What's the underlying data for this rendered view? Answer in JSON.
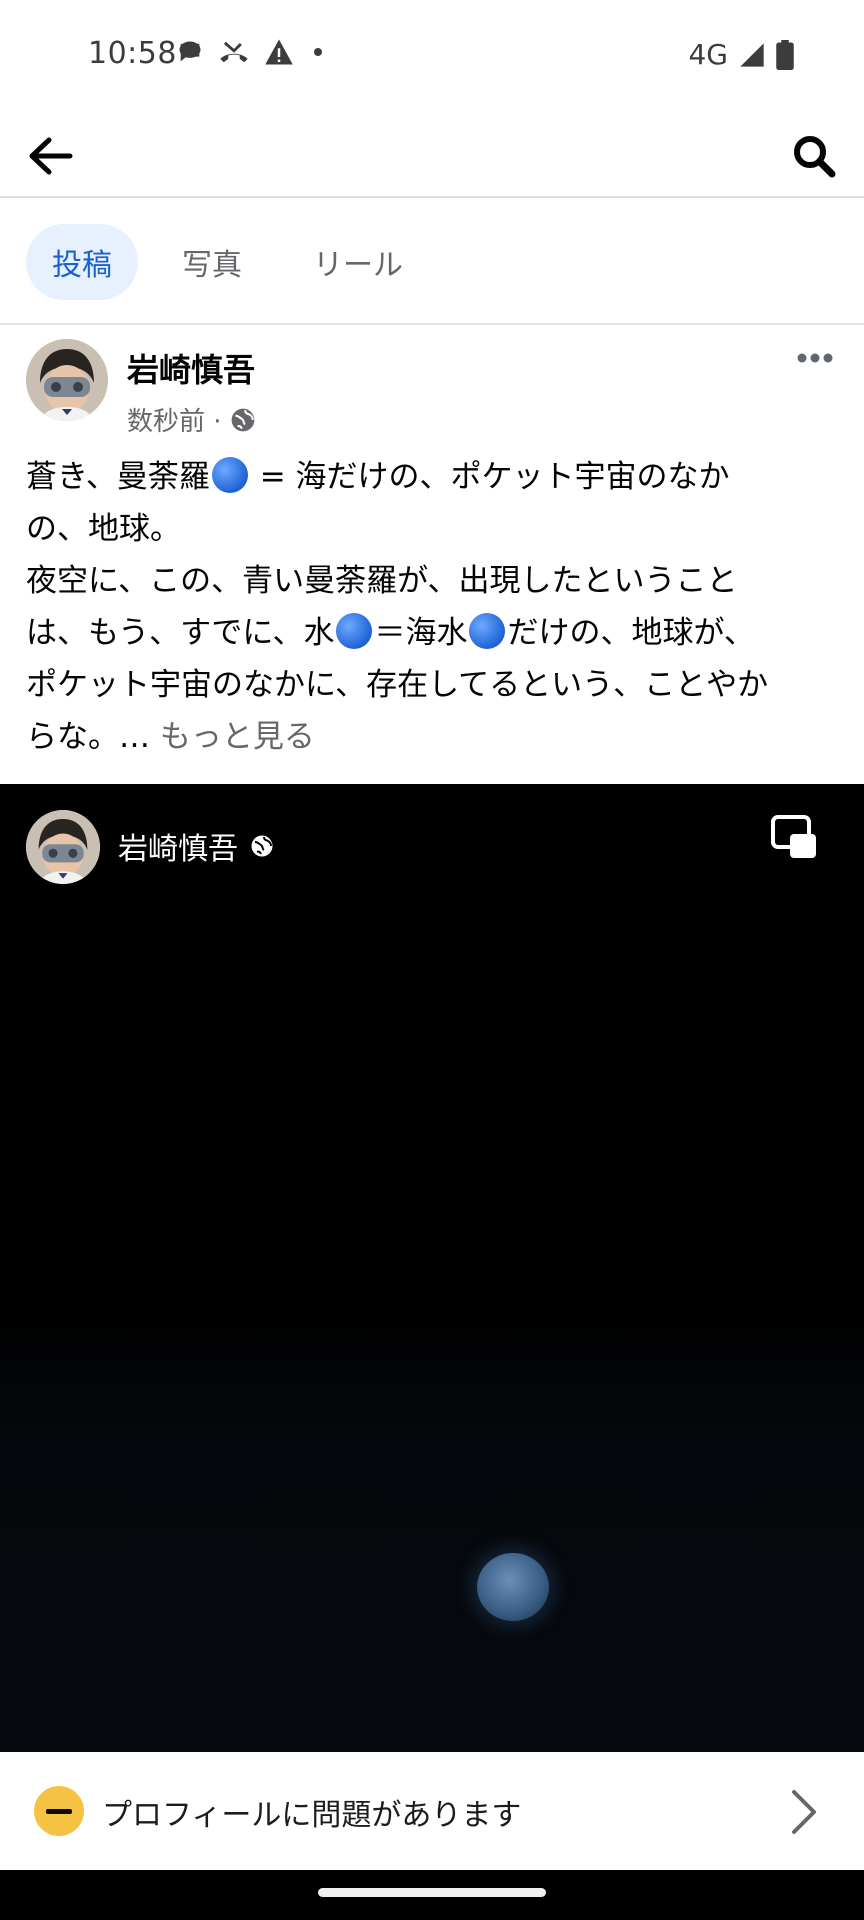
{
  "status_bar": {
    "time": "10:58",
    "network": "4G",
    "icons": [
      "chat-bubble-icon",
      "missed-call-icon",
      "warning-icon",
      "dot-icon",
      "signal-icon",
      "battery-icon"
    ]
  },
  "top_bar": {
    "back_icon": "arrow-left-icon",
    "search_icon": "search-icon"
  },
  "tabs": [
    {
      "label": "投稿",
      "active": true
    },
    {
      "label": "写真",
      "active": false
    },
    {
      "label": "リール",
      "active": false
    }
  ],
  "post": {
    "author": "岩崎慎吾",
    "meta": "数秒前 ·",
    "lines": {
      "l1a": "蒼き、曼荼羅",
      "l1b": " = 海だけの、ポケット宇宙のなか",
      "l2": "の、地球。",
      "l3": "夜空に、この、青い曼荼羅が、出現したということ",
      "l4a": "は、もう、すでに、水",
      "l4b": "＝海水",
      "l4c": "だけの、地球が、",
      "l5": "ポケット宇宙のなかに、存在してるという、ことやか",
      "l6": "らな。… "
    },
    "see_more": "もっと見る"
  },
  "media": {
    "author": "岩崎慎吾"
  },
  "banner": {
    "text": "プロフィールに問題があります"
  },
  "colors": {
    "tab_active_bg": "#e7f0fd",
    "tab_active_text": "#1b62d0",
    "secondary_text": "#65676b",
    "warning": "#f5c243"
  }
}
